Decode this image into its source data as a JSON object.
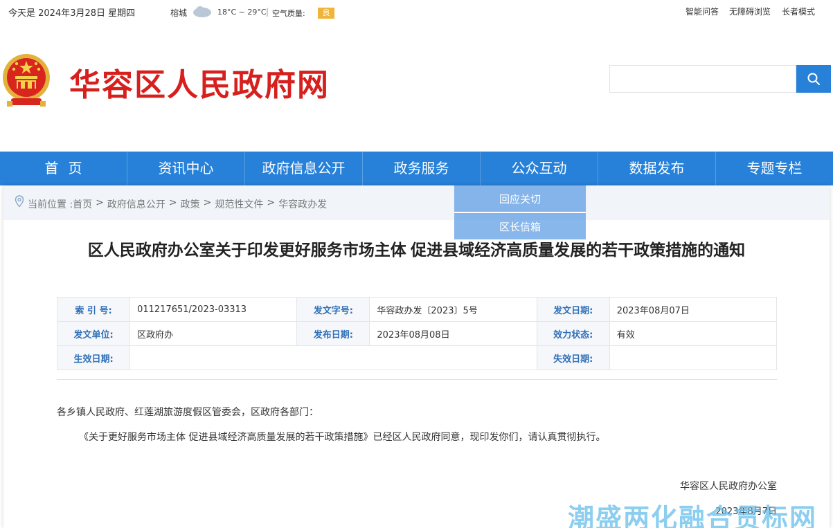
{
  "topbar": {
    "date": "今天是 2024年3月28日 星期四",
    "city": "榕城",
    "weather_icon": "cloud-icon",
    "temperature": "18°C ~ 29°C",
    "separator": "|",
    "air_quality_label": "空气质量:",
    "air_quality_value": "良",
    "air_quality_color": "#f0b43a",
    "links": [
      "智能问答",
      "无障碍浏览",
      "长者模式"
    ]
  },
  "header": {
    "emblem": "national-emblem",
    "site_title": "华容区人民政府网",
    "title_color": "#d6201d",
    "search_placeholder": "",
    "search_icon": "search-icon"
  },
  "nav": {
    "items": [
      "首页",
      "资讯中心",
      "政府信息公开",
      "政务服务",
      "公众互动",
      "数据发布",
      "专题专栏"
    ],
    "color": "#2781d8"
  },
  "dropdown": {
    "items": [
      "回应关切",
      "区长信箱"
    ]
  },
  "breadcrumb": {
    "prefix": "当前位置 :",
    "items": [
      "首页",
      "政府信息公开",
      "政策",
      "规范性文件",
      "华容政办发"
    ],
    "separator": ">"
  },
  "article": {
    "title": "区人民政府办公室关于印发更好服务市场主体 促进县域经济高质量发展的若干政策措施的通知",
    "meta": {
      "index_label": "索 引 号:",
      "index_value": "011217651/2023-03313",
      "doc_no_label": "发文字号:",
      "doc_no_value": "华容政办发〔2023〕5号",
      "issue_date_label": "发文日期:",
      "issue_date_value": "2023年08月07日",
      "issuer_label": "发文单位:",
      "issuer_value": "区政府办",
      "publish_date_label": "发布日期:",
      "publish_date_value": "2023年08月08日",
      "status_label": "效力状态:",
      "status_value": "有效",
      "effective_label": "生效日期:",
      "effective_value": "",
      "expire_label": "失效日期:",
      "expire_value": ""
    },
    "paragraphs": [
      "各乡镇人民政府、红莲湖旅游度假区管委会，区政府各部门：",
      "《关于更好服务市场主体  促进县域经济高质量发展的若干政策措施》已经区人民政府同意，现印发你们，请认真贯彻执行。"
    ],
    "signature": "华容区人民政府办公室",
    "signature_date": "2023年8月7日"
  },
  "watermark": "潮盛两化融合贯标网"
}
